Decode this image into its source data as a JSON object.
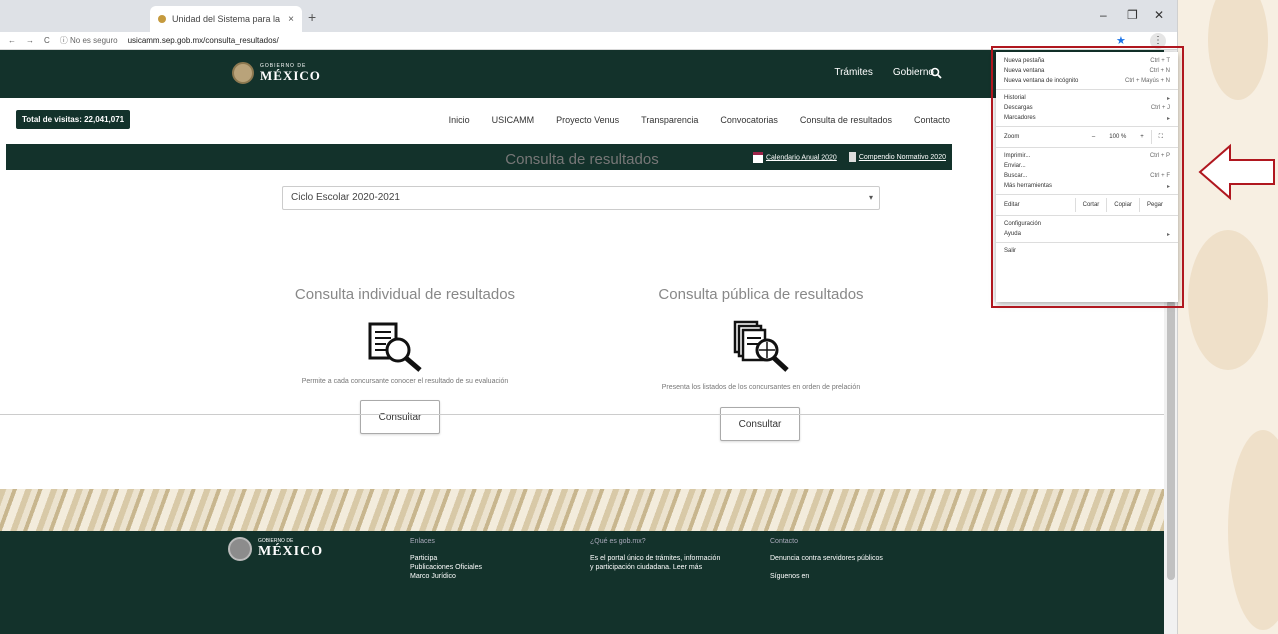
{
  "browser": {
    "tab_title": "Unidad del Sistema para la Carr",
    "tab_close": "×",
    "new_tab": "+",
    "win_min": "–",
    "win_max": "❐",
    "win_close": "✕",
    "nav_back": "←",
    "nav_forward": "→",
    "nav_reload": "C",
    "secure_label": "ⓘ No es seguro",
    "url": "usicamm.sep.gob.mx/consulta_resultados/",
    "star": "★",
    "menu": "⋮"
  },
  "header": {
    "logo_small": "GOBIERNO DE",
    "logo_big": "MÉXICO",
    "nav": [
      "Trámites",
      "Gobierno"
    ],
    "search_icon": "search-icon"
  },
  "subnav": {
    "visits": "Total de visitas: 22,041,071",
    "menu": [
      "Inicio",
      "USICAMM",
      "Proyecto Venus",
      "Transparencia",
      "Convocatorias",
      "Consulta de resultados",
      "Contacto"
    ]
  },
  "banner": {
    "calendar": "Calendario Anual 2020",
    "compendio": "Compendio Normativo 2020"
  },
  "main": {
    "title": "Consulta de resultados",
    "select_value": "Ciclo Escolar 2020-2021",
    "individual": {
      "title": "Consulta individual de resultados",
      "desc": "Permite a cada concursante conocer el resultado de su evaluación",
      "button": "Consultar"
    },
    "publica": {
      "title": "Consulta pública de resultados",
      "desc": "Presenta los listados de los concursantes en orden de prelación",
      "button": "Consultar"
    }
  },
  "footer": {
    "logo_small": "GOBIERNO DE",
    "logo_big": "MÉXICO",
    "col1_head": "Enlaces",
    "col1": [
      "Participa",
      "Publicaciones Oficiales",
      "Marco Jurídico"
    ],
    "col2_head": "¿Qué es gob.mx?",
    "col2": [
      "Es el portal único de trámites, información",
      "y participación ciudadana. Leer más"
    ],
    "col3_head": "Contacto",
    "col3": [
      "Denuncia contra servidores públicos",
      "",
      "Síguenos en"
    ]
  },
  "context_menu": {
    "items_top": [
      {
        "label": "Nueva pestaña",
        "shortcut": "Ctrl + T"
      },
      {
        "label": "Nueva ventana",
        "shortcut": "Ctrl + N"
      },
      {
        "label": "Nueva ventana de incógnito",
        "shortcut": "Ctrl + Mayús + N"
      }
    ],
    "items_mid": [
      {
        "label": "Historial",
        "shortcut": "▸"
      },
      {
        "label": "Descargas",
        "shortcut": "Ctrl + J"
      },
      {
        "label": "Marcadores",
        "shortcut": "▸"
      }
    ],
    "zoom": {
      "label": "Zoom",
      "minus": "–",
      "value": "100 %",
      "plus": "+",
      "fullscreen": "⛶"
    },
    "items_tools": [
      {
        "label": "Imprimir...",
        "shortcut": "Ctrl + P"
      },
      {
        "label": "Enviar...",
        "shortcut": ""
      },
      {
        "label": "Buscar...",
        "shortcut": "Ctrl + F"
      },
      {
        "label": "Más herramientas",
        "shortcut": "▸"
      }
    ],
    "edit": {
      "label": "Editar",
      "cut": "Cortar",
      "copy": "Copiar",
      "paste": "Pegar"
    },
    "items_bottom": [
      {
        "label": "Configuración",
        "shortcut": ""
      },
      {
        "label": "Ayuda",
        "shortcut": "▸"
      }
    ],
    "exit": "Salir"
  },
  "colors": {
    "gov_green": "#13322b",
    "highlight_red": "#b0171f",
    "deco_beige": "#f7efe2"
  }
}
